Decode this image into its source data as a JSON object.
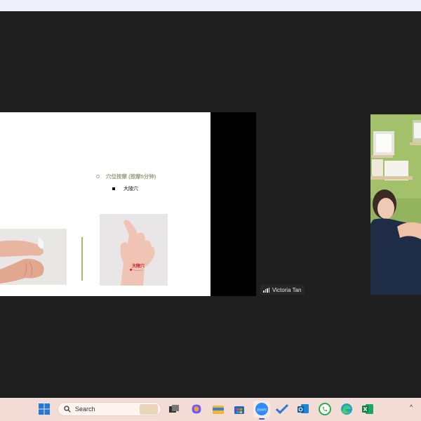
{
  "slide": {
    "bullet1": "穴位按摩 (按摩5分钟)",
    "bullet2": "大陵穴",
    "point_label": "大陵穴"
  },
  "participant": {
    "name": "Victoria Tan"
  },
  "taskbar": {
    "search_label": "Search",
    "zoom_label": "zoom",
    "chevron": "^",
    "icons": [
      "start-icon",
      "search-icon",
      "task-view-icon",
      "copilot-icon",
      "file-explorer-icon",
      "microsoft-store-icon",
      "zoom-icon",
      "todo-icon",
      "outlook-icon",
      "whatsapp-icon",
      "edge-icon",
      "excel-icon"
    ]
  },
  "colors": {
    "slide_accent": "#9a9f7e",
    "point_red": "#d21e2e",
    "taskbar_bg": "#f3dcd5"
  }
}
